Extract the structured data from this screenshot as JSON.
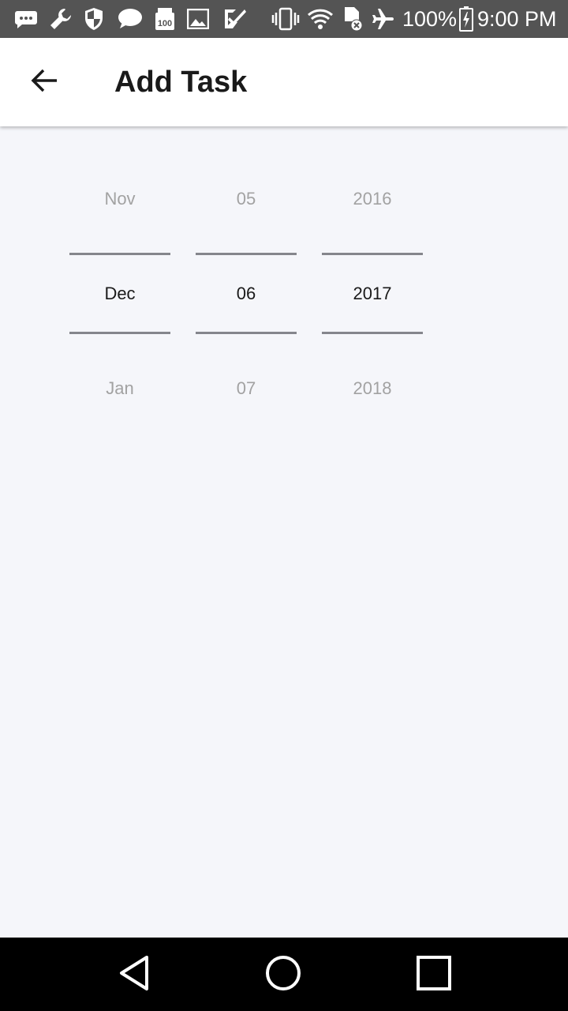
{
  "status_bar": {
    "battery": "100%",
    "time": "9:00 PM",
    "icons": [
      "message-icon",
      "wrench-icon",
      "shield-icon",
      "chat-icon",
      "storage-100-icon",
      "image-icon",
      "check-icon",
      "vibrate-icon",
      "wifi-icon",
      "sd-card-error-icon",
      "airplane-icon",
      "battery-charging-icon"
    ]
  },
  "app_bar": {
    "title": "Add Task",
    "back_icon": "arrow-back-icon"
  },
  "date_picker": {
    "month": {
      "prev": "Nov",
      "selected": "Dec",
      "next": "Jan"
    },
    "day": {
      "prev": "05",
      "selected": "06",
      "next": "07"
    },
    "year": {
      "prev": "2016",
      "selected": "2017",
      "next": "2018"
    }
  },
  "nav_bar": {
    "icons": [
      "back-triangle-icon",
      "home-circle-icon",
      "recents-square-icon"
    ]
  },
  "colors": {
    "background": "#f5f6fa",
    "status_bar": "#545454",
    "divider": "#85868c",
    "muted_text": "#a2a2a2"
  }
}
